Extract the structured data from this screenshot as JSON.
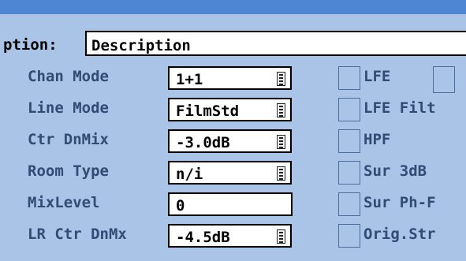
{
  "description": {
    "label": "ption:",
    "value": "Description"
  },
  "rows": [
    {
      "label": "Chan Mode",
      "value": "1+1",
      "has_dropdown": true,
      "flag": "LFE"
    },
    {
      "label": "Line Mode",
      "value": "FilmStd",
      "has_dropdown": true,
      "flag": "LFE Filt"
    },
    {
      "label": "Ctr DnMix",
      "value": "-3.0dB",
      "has_dropdown": true,
      "flag": "HPF"
    },
    {
      "label": "Room Type",
      "value": "n/i",
      "has_dropdown": true,
      "flag": "Sur 3dB"
    },
    {
      "label": "MixLevel",
      "value": "0",
      "has_dropdown": false,
      "flag": "Sur Ph-F"
    },
    {
      "label": "LR Ctr DnMx",
      "value": "-4.5dB",
      "has_dropdown": true,
      "flag": "Orig.Str"
    }
  ]
}
